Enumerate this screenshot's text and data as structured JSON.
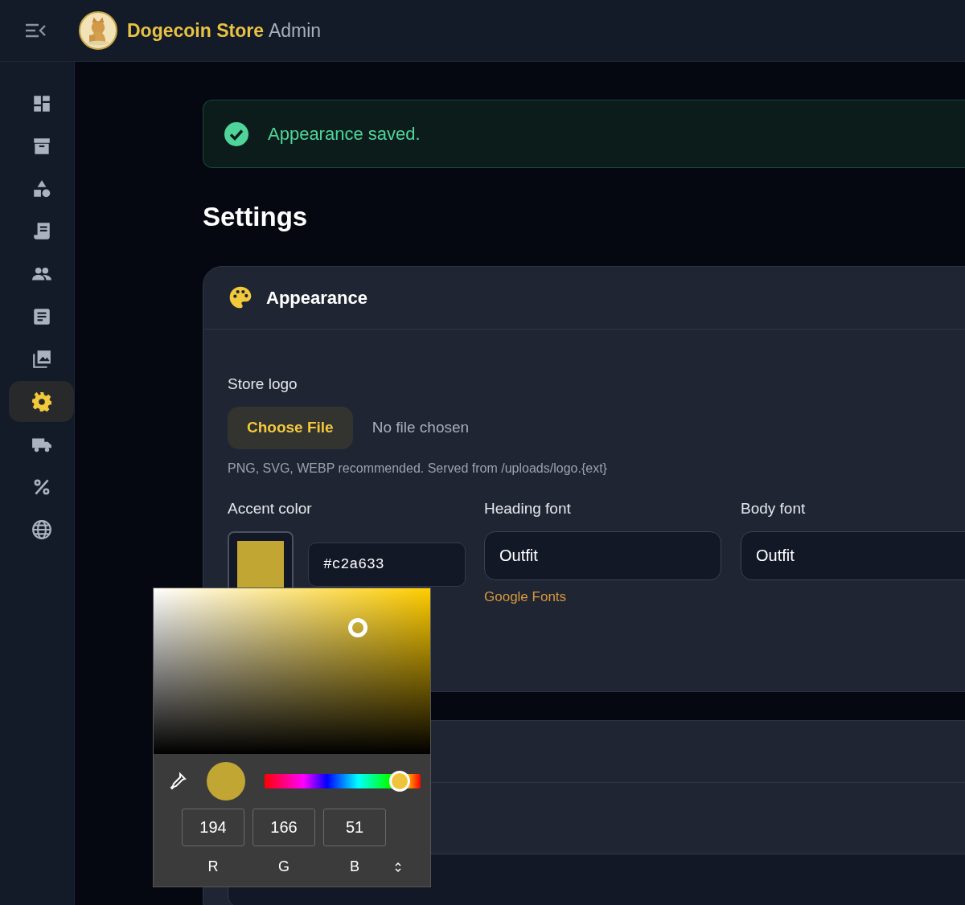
{
  "topbar": {
    "brand_primary": "Dogecoin Store",
    "brand_secondary": "Admin"
  },
  "sidebar": {
    "items": [
      {
        "selected": false
      },
      {
        "selected": false
      },
      {
        "selected": false
      },
      {
        "selected": false
      },
      {
        "selected": false
      },
      {
        "selected": false
      },
      {
        "selected": false
      },
      {
        "selected": true
      },
      {
        "selected": false
      },
      {
        "selected": false
      },
      {
        "selected": false
      }
    ]
  },
  "alert": {
    "text": "Appearance saved."
  },
  "page_title": "Settings",
  "appearance_card": {
    "title": "Appearance",
    "store_logo": {
      "label": "Store logo",
      "button": "Choose File",
      "status": "No file chosen",
      "hint": "PNG, SVG, WEBP recommended. Served from /uploads/logo.{ext}"
    },
    "accent_color": {
      "label": "Accent color",
      "value": "#c2a633"
    },
    "heading_font": {
      "label": "Heading font",
      "value": "Outfit",
      "link": "Google Fonts"
    },
    "body_font": {
      "label": "Body font",
      "value": "Outfit"
    }
  },
  "color_picker": {
    "hue_slider": {
      "level": 0.866
    },
    "channels": [
      {
        "value": "194",
        "label": "R"
      },
      {
        "value": "166",
        "label": "G"
      },
      {
        "value": "51",
        "label": "B"
      }
    ]
  }
}
